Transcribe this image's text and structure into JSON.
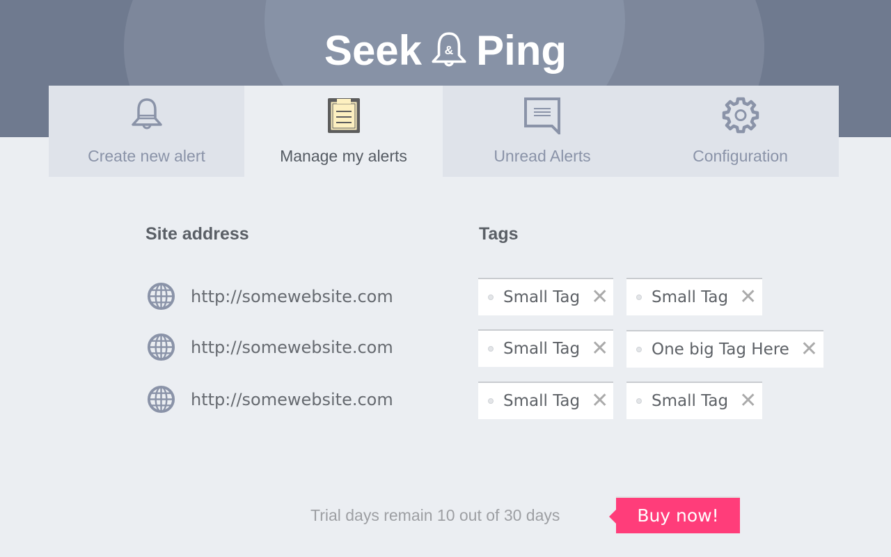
{
  "app": {
    "title_left": "Seek",
    "title_mark": "&",
    "title_right": "Ping",
    "logo_icon": "bell-ampersand-icon"
  },
  "tabs": [
    {
      "label": "Create new alert",
      "icon": "bell-icon",
      "active": false
    },
    {
      "label": "Manage my alerts",
      "icon": "clipboard-icon",
      "active": true
    },
    {
      "label": "Unread Alerts",
      "icon": "speech-bubble-icon",
      "active": false
    },
    {
      "label": "Configuration",
      "icon": "gear-icon",
      "active": false
    }
  ],
  "columns": {
    "site": "Site address",
    "tags": "Tags"
  },
  "alerts": [
    {
      "url": "http://somewebsite.com",
      "icon": "globe-icon",
      "tags": [
        "Small Tag",
        "Small Tag"
      ]
    },
    {
      "url": "http://somewebsite.com",
      "icon": "globe-icon",
      "tags": [
        "Small Tag",
        "One big Tag Here"
      ]
    },
    {
      "url": "http://somewebsite.com",
      "icon": "globe-icon",
      "tags": [
        "Small Tag",
        "Small Tag"
      ]
    }
  ],
  "tag_remove_glyph": "✕",
  "footer": {
    "trial_text": "Trial days remain 10 out of 30 days",
    "trial_days_remaining": 10,
    "trial_days_total": 30,
    "buy_label": "Buy now!"
  },
  "colors": {
    "header": "#6f7a8f",
    "accent_buy": "#ff3d7a",
    "icon": "#8a93a8",
    "clipboard_fill": "#fdf0c0"
  }
}
